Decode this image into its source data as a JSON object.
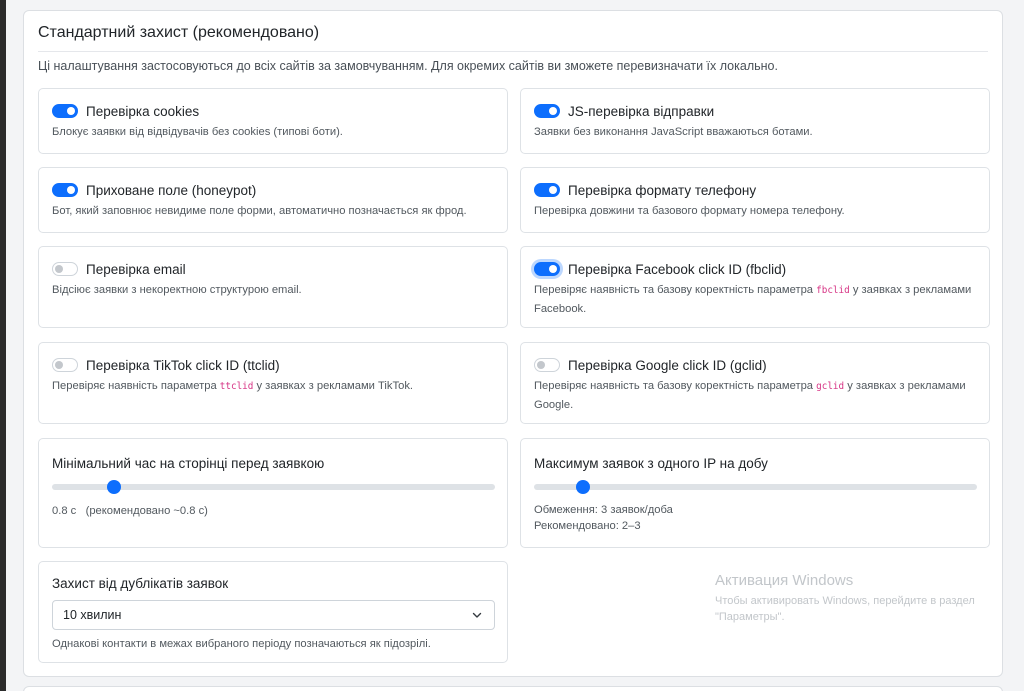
{
  "section": {
    "title": "Стандартний захист (рекомендовано)",
    "description": "Ці налаштування застосовуються до всіх сайтів за замовчуванням. Для окремих сайтів ви зможете перевизначати їх локально."
  },
  "checks": {
    "cookies": {
      "title": "Перевірка cookies",
      "enabled": true,
      "desc": "Блокує заявки від відвідувачів без cookies (типові боти)."
    },
    "js": {
      "title": "JS-перевірка відправки",
      "enabled": true,
      "desc": "Заявки без виконання JavaScript вважаються ботами."
    },
    "honeypot": {
      "title": "Приховане поле (honeypot)",
      "enabled": true,
      "desc": "Бот, який заповнює невидиме поле форми, автоматично позначається як фрод."
    },
    "phone": {
      "title": "Перевірка формату телефону",
      "enabled": true,
      "desc": "Перевірка довжини та базового формату номера телефону."
    },
    "email": {
      "title": "Перевірка email",
      "enabled": false,
      "desc": "Відсіює заявки з некоректною структурою email."
    },
    "fbclid": {
      "title": "Перевірка Facebook click ID (fbclid)",
      "enabled": true,
      "desc_before": "Перевіряє наявність та базову коректність параметра",
      "param": "fbclid",
      "desc_after": "у заявках з рекламами",
      "desc_line2": "Facebook."
    },
    "ttclid": {
      "title": "Перевірка TikTok click ID (ttclid)",
      "enabled": false,
      "desc_before": "Перевіряє наявність параметра",
      "param": "ttclid",
      "desc_after": "у заявках з рекламами TikTok."
    },
    "gclid": {
      "title": "Перевірка Google click ID (gclid)",
      "enabled": false,
      "desc_before": "Перевіряє наявність та базову коректність параметра",
      "param": "gclid",
      "desc_after": "у заявках з рекламами",
      "desc_line2": "Google."
    }
  },
  "min_time": {
    "label": "Мінімальний час на сторінці перед заявкою",
    "slider_fraction": 0.14,
    "value_text": "0.8 с",
    "recommended_text": "(рекомендовано ~0.8 с)"
  },
  "max_per_ip": {
    "label": "Максимум заявок з одного IP на добу",
    "slider_fraction": 0.11,
    "limit_text": "Обмеження: 3 заявок/доба",
    "recommended_text": "Рекомендовано: 2–3"
  },
  "duplicates": {
    "label": "Захист від дублікатів заявок",
    "selected": "10 хвилин",
    "hint": "Однакові контакти в межах вибраного періоду позначаються як підозрілі."
  },
  "watermark": {
    "title": "Активация Windows",
    "subtitle": "Чтобы активировать Windows, перейдите в раздел \"Параметры\"."
  },
  "colors": {
    "accent": "#0d6efd",
    "param": "#d63384",
    "border": "#dee2e6"
  }
}
